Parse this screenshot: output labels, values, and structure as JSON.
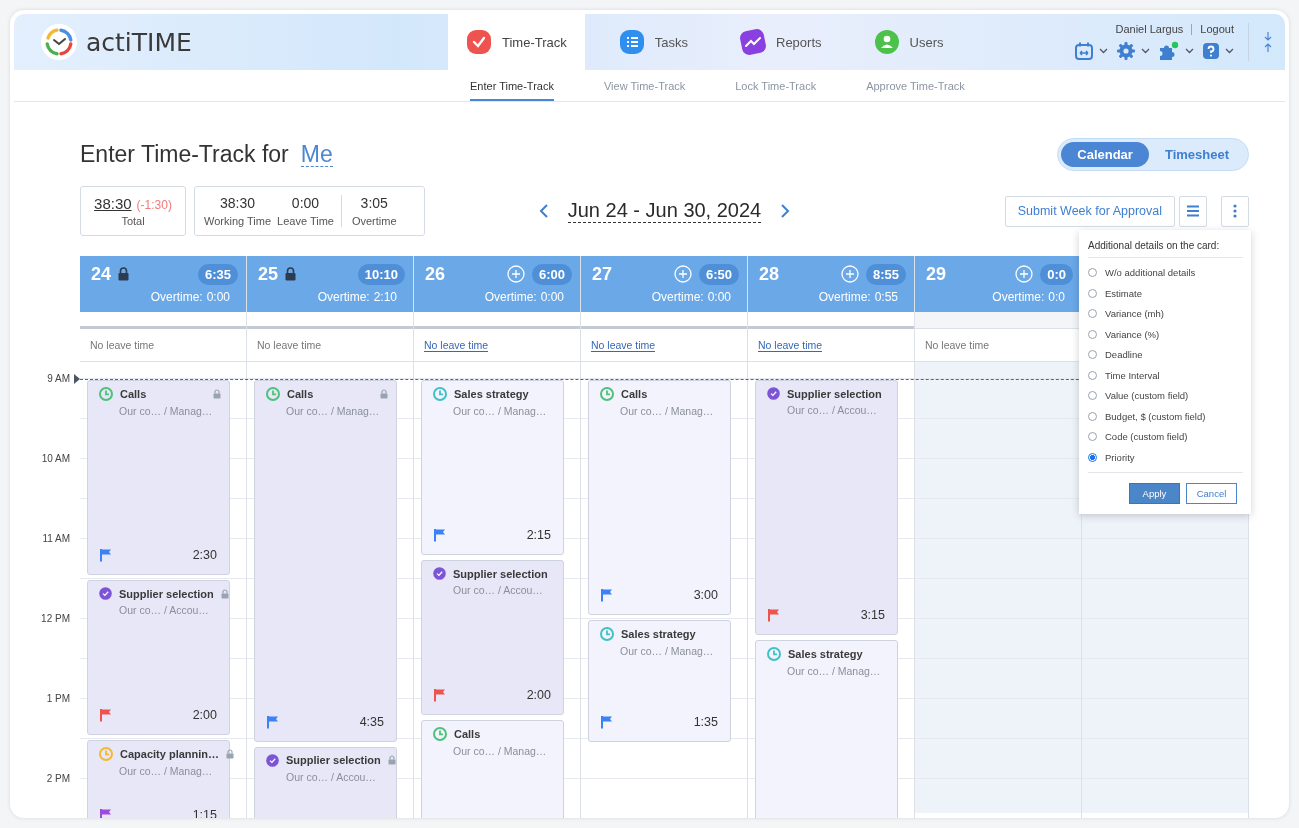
{
  "header": {
    "logo": "actiTIME",
    "tabs": [
      {
        "label": "Time-Track",
        "kind": "check",
        "selected": true
      },
      {
        "label": "Tasks",
        "kind": "list",
        "selected": false
      },
      {
        "label": "Reports",
        "kind": "chart",
        "selected": false
      },
      {
        "label": "Users",
        "kind": "user",
        "selected": false
      }
    ],
    "user": "Daniel Largus",
    "logout": "Logout"
  },
  "subnav": [
    {
      "label": "Enter Time-Track",
      "selected": true
    },
    {
      "label": "View Time-Track",
      "selected": false
    },
    {
      "label": "Lock Time-Track",
      "selected": false
    },
    {
      "label": "Approve Time-Track",
      "selected": false
    }
  ],
  "page": {
    "title": "Enter Time-Track for",
    "person": "Me",
    "view_toggle": [
      {
        "label": "Calendar",
        "selected": true
      },
      {
        "label": "Timesheet",
        "selected": false
      }
    ]
  },
  "summary": {
    "total": "38:30",
    "difference": "(-1:30)",
    "total_label": "Total",
    "stats": [
      {
        "value": "38:30",
        "label": "Working Time"
      },
      {
        "value": "0:00",
        "label": "Leave Time"
      },
      {
        "value": "3:05",
        "label": "Overtime"
      }
    ]
  },
  "week": {
    "range": "Jun 24 - Jun 30, 2024"
  },
  "actions": {
    "submit": "Submit Week for Approval"
  },
  "card_options": {
    "title": "Additional details on the card:",
    "options": [
      {
        "label": "W/o additional details",
        "selected": false
      },
      {
        "label": "Estimate",
        "selected": false
      },
      {
        "label": "Variance (mh)",
        "selected": false
      },
      {
        "label": "Variance (%)",
        "selected": false
      },
      {
        "label": "Deadline",
        "selected": false
      },
      {
        "label": "Time Interval",
        "selected": false
      },
      {
        "label": "Value (custom field)",
        "selected": false
      },
      {
        "label": "Budget, $ (custom field)",
        "selected": false
      },
      {
        "label": "Code (custom field)",
        "selected": false
      },
      {
        "label": "Priority",
        "selected": true
      }
    ],
    "apply": "Apply",
    "cancel": "Cancel"
  },
  "time_axis": [
    "9 AM",
    "10 AM",
    "11 AM",
    "12 PM",
    "1 PM",
    "2 PM"
  ],
  "days": [
    {
      "day": "24",
      "locked": true,
      "total": "6:35",
      "overtime_label": "Overtime:",
      "overtime": "0:00",
      "leave": "No leave time",
      "leave_link": false,
      "weekend": false,
      "cards": [
        {
          "title": "Calls",
          "path": "Our co… / Manag…",
          "kind": "clock",
          "color": "#4cc27a",
          "locked": true,
          "flag": {
            "color": "#3b82f6"
          },
          "duration": "2:30"
        },
        {
          "title": "Supplier selection",
          "path": "Our co… / Accou…",
          "kind": "done",
          "color": "#7b55d6",
          "locked": true,
          "flag": {
            "color": "#ef5350"
          },
          "duration": "2:00"
        },
        {
          "title": "Capacity plannin…",
          "path": "Our co… / Manag…",
          "kind": "clock",
          "color": "#f2b933",
          "locked": true,
          "flag": {
            "color": "#9b4de0"
          },
          "duration": "1:15"
        }
      ]
    },
    {
      "day": "25",
      "locked": true,
      "total": "10:10",
      "overtime_label": "Overtime:",
      "overtime": "2:10",
      "leave": "No leave time",
      "leave_link": false,
      "weekend": false,
      "cards": [
        {
          "title": "Calls",
          "path": "Our co… / Manag…",
          "kind": "clock",
          "color": "#4cc27a",
          "locked": true,
          "flag": {
            "color": "#3b82f6"
          },
          "duration": "4:35"
        },
        {
          "title": "Supplier selection",
          "path": "Our co… / Accou…",
          "kind": "done",
          "color": "#7b55d6",
          "locked": true
        }
      ]
    },
    {
      "day": "26",
      "locked": false,
      "total": "6:00",
      "overtime_label": "Overtime:",
      "overtime": "0:00",
      "leave": "No leave time",
      "leave_link": true,
      "weekend": false,
      "cards": [
        {
          "title": "Sales strategy",
          "path": "Our co… / Manag…",
          "kind": "clock",
          "color": "#3fc1c9",
          "locked": false,
          "flag": {
            "color": "#3b82f6"
          },
          "duration": "2:15"
        },
        {
          "title": "Supplier selection",
          "path": "Our co… / Accou…",
          "kind": "done",
          "color": "#7b55d6",
          "locked": false,
          "flag": {
            "color": "#ef5350"
          },
          "duration": "2:00"
        },
        {
          "title": "Calls",
          "path": "Our co… / Manag…",
          "kind": "clock",
          "color": "#4cc27a",
          "locked": false
        }
      ]
    },
    {
      "day": "27",
      "locked": false,
      "total": "6:50",
      "overtime_label": "Overtime:",
      "overtime": "0:00",
      "leave": "No leave time",
      "leave_link": true,
      "weekend": false,
      "cards": [
        {
          "title": "Calls",
          "path": "Our co… / Manag…",
          "kind": "clock",
          "color": "#4cc27a",
          "locked": false,
          "flag": {
            "color": "#3b82f6"
          },
          "duration": "3:00"
        },
        {
          "title": "Sales strategy",
          "path": "Our co… / Manag…",
          "kind": "clock",
          "color": "#3fc1c9",
          "locked": false,
          "flag": {
            "color": "#3b82f6"
          },
          "duration": "1:35"
        }
      ]
    },
    {
      "day": "28",
      "locked": false,
      "total": "8:55",
      "overtime_label": "Overtime:",
      "overtime": "0:55",
      "leave": "No leave time",
      "leave_link": true,
      "weekend": false,
      "cards": [
        {
          "title": "Supplier selection",
          "path": "Our co… / Accou…",
          "kind": "done",
          "color": "#7b55d6",
          "locked": false,
          "flag": {
            "color": "#ef5350"
          },
          "duration": "3:15"
        },
        {
          "title": "Sales strategy",
          "path": "Our co… / Manag…",
          "kind": "clock",
          "color": "#3fc1c9",
          "locked": false
        }
      ]
    },
    {
      "day": "29",
      "locked": false,
      "total": "0:0",
      "overtime_label": "Overtime:",
      "overtime": "0:0",
      "leave": "No leave time",
      "leave_link": false,
      "weekend": true
    },
    {
      "weekend": true
    }
  ]
}
